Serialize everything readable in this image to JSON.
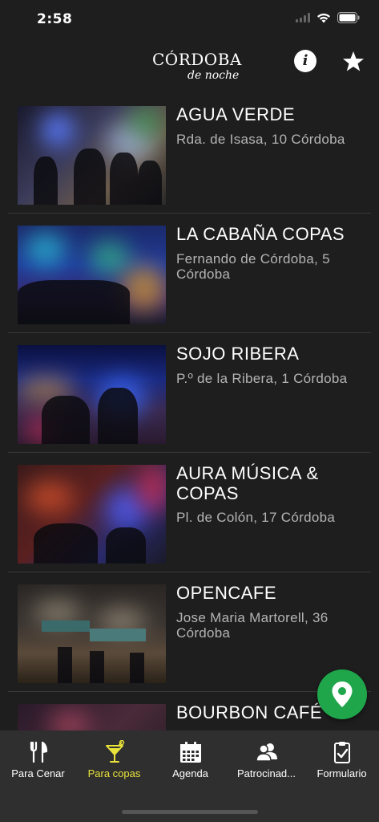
{
  "status_bar": {
    "time": "2:58"
  },
  "header": {
    "logo_title": "CÓRDOBA",
    "logo_subtitle": "de noche",
    "info_label": "i"
  },
  "venues": [
    {
      "name": "AGUA VERDE",
      "address": "Rda. de Isasa, 10 Córdoba"
    },
    {
      "name": "LA CABAÑA COPAS",
      "address": "Fernando de Córdoba, 5 Córdoba"
    },
    {
      "name": "SOJO RIBERA",
      "address": "P.º de la Ribera, 1 Córdoba"
    },
    {
      "name": "AURA MÚSICA & COPAS",
      "address": "Pl. de Colón, 17 Córdoba"
    },
    {
      "name": "OPENCAFE",
      "address": "Jose Maria Martorell, 36 Córdoba"
    },
    {
      "name": "BOURBON CAFÉ",
      "address": ""
    }
  ],
  "tabs": [
    {
      "label": "Para Cenar",
      "icon": "cutlery-icon",
      "active": false
    },
    {
      "label": "Para copas",
      "icon": "cocktail-icon",
      "active": true
    },
    {
      "label": "Agenda",
      "icon": "calendar-icon",
      "active": false
    },
    {
      "label": "Patrocinad...",
      "icon": "users-icon",
      "active": false
    },
    {
      "label": "Formulario",
      "icon": "clipboard-icon",
      "active": false
    }
  ],
  "colors": {
    "background": "#1e1e1e",
    "tabbar": "#2f2f2f",
    "accent": "#e9e23a",
    "map_button": "#1fa64a",
    "address_text": "#b4b4b4"
  }
}
